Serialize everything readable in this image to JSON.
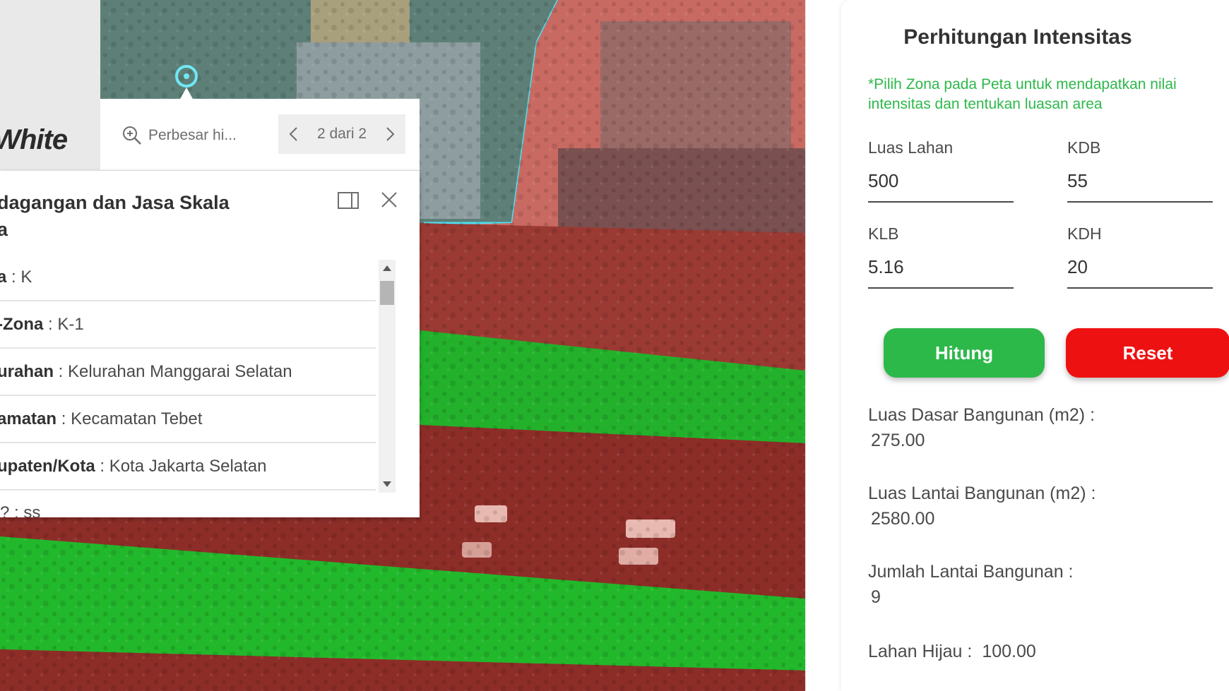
{
  "map": {
    "logo_text": "yWhite",
    "toolbar": {
      "zoom_label": "Perbesar hi...",
      "pager_label": "2 dari 2"
    },
    "popup": {
      "title_line1": "dagangan dan Jasa Skala",
      "title_line2": "a",
      "attributes": [
        {
          "key": "a",
          "value": "K"
        },
        {
          "key": "-Zona",
          "value": "K-1"
        },
        {
          "key": "urahan",
          "value": "Kelurahan Manggarai Selatan"
        },
        {
          "key": "amatan",
          "value": "Kecamatan Tebet"
        },
        {
          "key": "upaten/Kota",
          "value": "Kota Jakarta Selatan"
        }
      ],
      "partial_row": "? : ss"
    },
    "zone_colors": {
      "red": "#b22222",
      "green": "#22c02b",
      "outline": "#4fe0f0"
    }
  },
  "panel": {
    "title": "Perhitungan Intensitas",
    "note": "*Pilih Zona pada Peta untuk mendapatkan nilai intensitas dan tentukan luasan area",
    "fields": {
      "luas_lahan": {
        "label": "Luas Lahan",
        "value": "500"
      },
      "kdb": {
        "label": "KDB",
        "value": "55"
      },
      "klb": {
        "label": "KLB",
        "value": "5.16"
      },
      "kdh": {
        "label": "KDH",
        "value": "20"
      }
    },
    "buttons": {
      "hitung": "Hitung",
      "reset": "Reset"
    },
    "results": {
      "ldb": {
        "label": "Luas Dasar Bangunan (m2) :",
        "value": "275.00"
      },
      "llb": {
        "label": "Luas Lantai Bangunan (m2) :",
        "value": "2580.00"
      },
      "jlb": {
        "label": "Jumlah Lantai Bangunan :",
        "value": "9"
      },
      "lh": {
        "label": "Lahan Hijau :",
        "value": "100.00"
      }
    },
    "colors": {
      "accent_green": "#2db84a",
      "reset_red": "#ee1111"
    }
  }
}
